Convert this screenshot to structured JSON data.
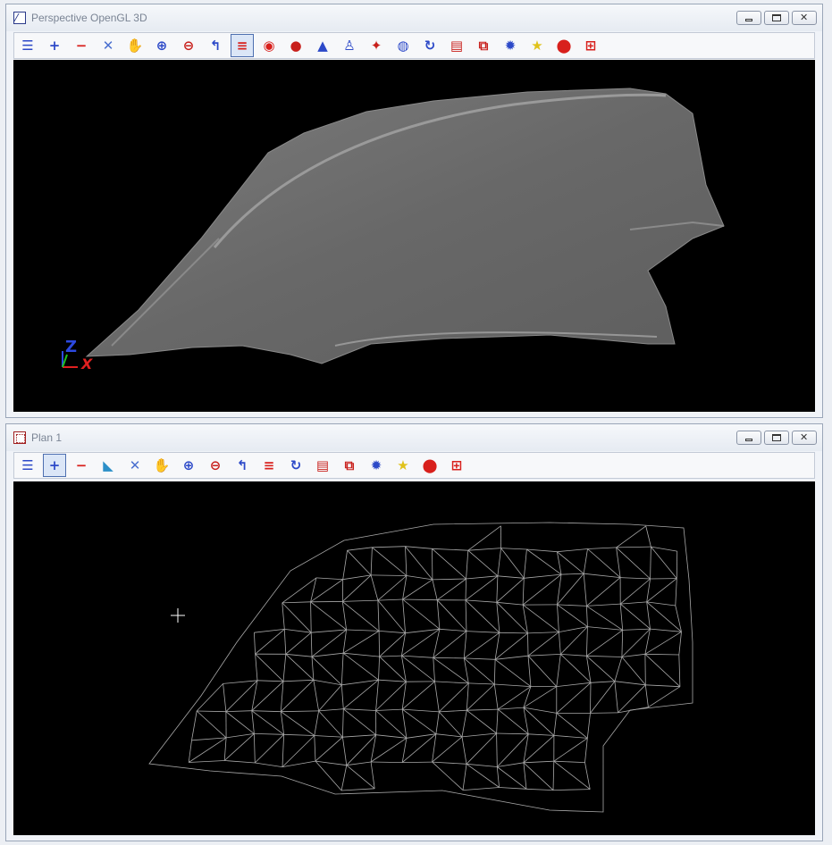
{
  "windows": [
    {
      "title": "Perspective OpenGL 3D",
      "toolbar": [
        {
          "icon": "menu-icon",
          "glyph": "☰",
          "color": "#2c49c8"
        },
        {
          "icon": "zoom-in-plus-icon",
          "glyph": "+",
          "color": "#2c49c8"
        },
        {
          "icon": "zoom-out-minus-icon",
          "glyph": "−",
          "color": "#d8201c"
        },
        {
          "icon": "zoom-extents-icon",
          "glyph": "✕",
          "color": "#4a6fcf"
        },
        {
          "icon": "pan-hand-icon",
          "glyph": "✋",
          "color": "#2c49c8"
        },
        {
          "icon": "zoom-window-icon",
          "glyph": "⊕",
          "color": "#2c49c8"
        },
        {
          "icon": "zoom-magnify-icon",
          "glyph": "⊖",
          "color": "#c8201c"
        },
        {
          "icon": "undo-view-icon",
          "glyph": "↰",
          "color": "#2c49c8"
        },
        {
          "icon": "layers-icon",
          "glyph": "≡",
          "color": "#d8201c",
          "active": true
        },
        {
          "icon": "eye-view-icon",
          "glyph": "◉",
          "color": "#d8201c"
        },
        {
          "icon": "shading-icon",
          "glyph": "●",
          "color": "#c8201c"
        },
        {
          "icon": "model-icon",
          "glyph": "▲",
          "color": "#2c49c8"
        },
        {
          "icon": "joystick-icon",
          "glyph": "♙",
          "color": "#2c49c8"
        },
        {
          "icon": "walk-icon",
          "glyph": "✦",
          "color": "#c8201c"
        },
        {
          "icon": "steering-wheel-icon",
          "glyph": "◍",
          "color": "#2c49c8"
        },
        {
          "icon": "refresh-icon",
          "glyph": "↻",
          "color": "#2c49c8"
        },
        {
          "icon": "print-icon",
          "glyph": "▤",
          "color": "#c8201c"
        },
        {
          "icon": "copy-view-icon",
          "glyph": "⧉",
          "color": "#c8201c"
        },
        {
          "icon": "settings-gear-icon",
          "glyph": "✹",
          "color": "#2c49c8"
        },
        {
          "icon": "favorites-star-icon",
          "glyph": "★",
          "color": "#e0c21a"
        },
        {
          "icon": "location-pin-icon",
          "glyph": "⬤",
          "color": "#d8201c"
        },
        {
          "icon": "tile-windows-icon",
          "glyph": "⊞",
          "color": "#d8201c"
        }
      ]
    },
    {
      "title": "Plan 1",
      "toolbar": [
        {
          "icon": "menu-icon",
          "glyph": "☰",
          "color": "#2c49c8"
        },
        {
          "icon": "zoom-in-plus-icon",
          "glyph": "+",
          "color": "#2c49c8",
          "active": true
        },
        {
          "icon": "zoom-out-minus-icon",
          "glyph": "−",
          "color": "#d8201c"
        },
        {
          "icon": "shovel-icon",
          "glyph": "◣",
          "color": "#2c8fc8"
        },
        {
          "icon": "zoom-extents-icon",
          "glyph": "✕",
          "color": "#4a6fcf"
        },
        {
          "icon": "pan-hand-icon",
          "glyph": "✋",
          "color": "#2c49c8"
        },
        {
          "icon": "zoom-window-icon",
          "glyph": "⊕",
          "color": "#2c49c8"
        },
        {
          "icon": "zoom-magnify-icon",
          "glyph": "⊖",
          "color": "#c8201c"
        },
        {
          "icon": "undo-view-icon",
          "glyph": "↰",
          "color": "#2c49c8"
        },
        {
          "icon": "layers-icon",
          "glyph": "≡",
          "color": "#d8201c"
        },
        {
          "icon": "refresh-icon",
          "glyph": "↻",
          "color": "#2c49c8"
        },
        {
          "icon": "print-icon",
          "glyph": "▤",
          "color": "#c8201c"
        },
        {
          "icon": "copy-view-icon",
          "glyph": "⧉",
          "color": "#c8201c"
        },
        {
          "icon": "settings-gear-icon",
          "glyph": "✹",
          "color": "#2c49c8"
        },
        {
          "icon": "favorites-star-icon",
          "glyph": "★",
          "color": "#e0c21a"
        },
        {
          "icon": "location-pin-icon",
          "glyph": "⬤",
          "color": "#d8201c"
        },
        {
          "icon": "tile-windows-icon",
          "glyph": "⊞",
          "color": "#d8201c"
        }
      ]
    }
  ],
  "axes": {
    "z": "Z",
    "x": "X"
  },
  "colors": {
    "viewport": "#000000",
    "surface": "#6e6e6e",
    "mesh": "#b0b0b0"
  }
}
